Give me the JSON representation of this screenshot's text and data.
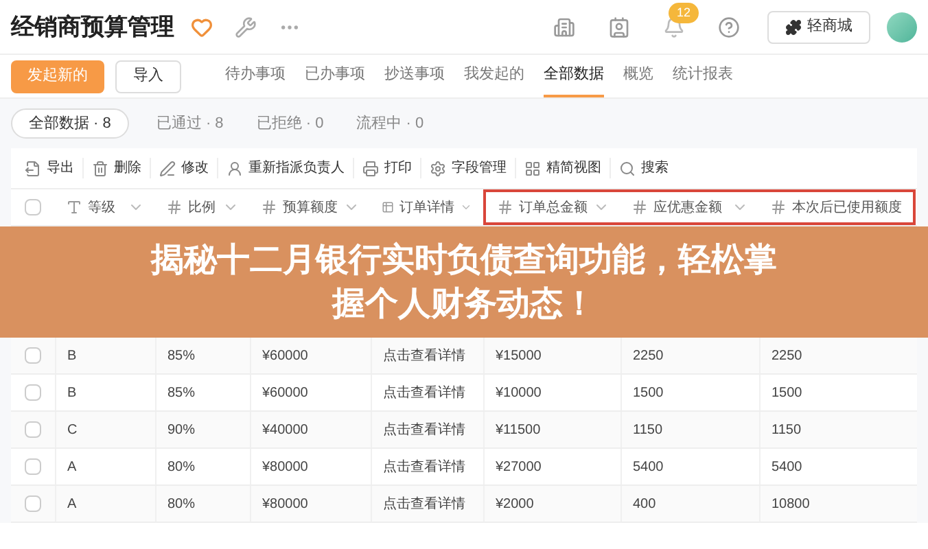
{
  "header": {
    "title": "经销商预算管理",
    "notification_count": "12",
    "shop_button": "轻商城"
  },
  "actions": {
    "primary": "发起新的",
    "secondary": "导入"
  },
  "tabs": [
    {
      "label": "待办事项",
      "selected": false
    },
    {
      "label": "已办事项",
      "selected": false
    },
    {
      "label": "抄送事项",
      "selected": false
    },
    {
      "label": "我发起的",
      "selected": false
    },
    {
      "label": "全部数据",
      "selected": true
    },
    {
      "label": "概览",
      "selected": false
    },
    {
      "label": "统计报表",
      "selected": false
    }
  ],
  "filters": [
    {
      "label": "全部数据 · 8",
      "selected": true
    },
    {
      "label": "已通过 · 8",
      "selected": false
    },
    {
      "label": "已拒绝 · 0",
      "selected": false
    },
    {
      "label": "流程中 · 0",
      "selected": false
    }
  ],
  "toolbar": [
    {
      "label": "导出",
      "kind": "export"
    },
    {
      "label": "删除",
      "kind": "delete"
    },
    {
      "label": "修改",
      "kind": "edit"
    },
    {
      "label": "重新指派负责人",
      "kind": "assign"
    },
    {
      "label": "打印",
      "kind": "print"
    },
    {
      "label": "字段管理",
      "kind": "fields"
    },
    {
      "label": "精简视图",
      "kind": "grid"
    },
    {
      "label": "搜索",
      "kind": "search"
    }
  ],
  "table": {
    "all_checked": false,
    "columns": [
      {
        "label": "等级",
        "kind": "text",
        "highlighted": false
      },
      {
        "label": "比例",
        "kind": "number",
        "highlighted": false
      },
      {
        "label": "预算额度",
        "kind": "number",
        "highlighted": false
      },
      {
        "label": "订单详情",
        "kind": "table",
        "highlighted": false
      },
      {
        "label": "订单总金额",
        "kind": "number",
        "highlighted": true
      },
      {
        "label": "应优惠金额",
        "kind": "number",
        "highlighted": true
      },
      {
        "label": "本次后已使用额度",
        "kind": "number",
        "highlighted": true
      }
    ],
    "rows": [
      {
        "checked": false,
        "cells": [
          "B",
          "85%",
          "¥60000",
          "点击查看详情",
          "¥15000",
          "2250",
          "2250"
        ]
      },
      {
        "checked": false,
        "cells": [
          "B",
          "85%",
          "¥60000",
          "点击查看详情",
          "¥10000",
          "1500",
          "1500"
        ]
      },
      {
        "checked": false,
        "cells": [
          "C",
          "90%",
          "¥40000",
          "点击查看详情",
          "¥11500",
          "1150",
          "1150"
        ]
      },
      {
        "checked": false,
        "cells": [
          "A",
          "80%",
          "¥80000",
          "点击查看详情",
          "¥27000",
          "5400",
          "5400"
        ]
      },
      {
        "checked": false,
        "cells": [
          "A",
          "80%",
          "¥80000",
          "点击查看详情",
          "¥2000",
          "400",
          "10800"
        ]
      }
    ]
  },
  "banner": {
    "lines": [
      "揭秘十二月银行实时负债查询功能，轻松掌",
      "握个人财务动态！"
    ]
  }
}
